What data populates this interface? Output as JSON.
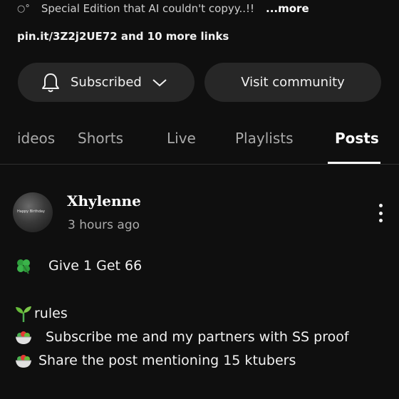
{
  "description": {
    "bullet": "○°",
    "text": "Special Edition that AI couldn't copyy..!!",
    "more": "...more"
  },
  "links_text": "pin.it/3Z2j2UE72 and 10 more links",
  "buttons": {
    "subscribed_label": "Subscribed",
    "visit_label": "Visit community"
  },
  "tabs": [
    {
      "label": "ideos",
      "active": false
    },
    {
      "label": "Shorts",
      "active": false
    },
    {
      "label": "Live",
      "active": false
    },
    {
      "label": "Playlists",
      "active": false
    },
    {
      "label": "Posts",
      "active": true
    }
  ],
  "post": {
    "author": "Xhylenne",
    "time": "3 hours ago",
    "avatar_text": "Happy Birthday",
    "lines": [
      {
        "emoji": "four-leaf-clover-icon",
        "text": "Give 1 Get 66"
      },
      {
        "emoji": "seedling-icon",
        "text": "rules"
      },
      {
        "emoji": "salad-bowl-icon",
        "text": "Subscribe me and my partners with SS proof"
      },
      {
        "emoji": "salad-bowl-icon",
        "text": "Share the post mentioning 15 ktubers"
      }
    ]
  },
  "colors": {
    "background": "#0f0f0f",
    "button_bg": "#272727",
    "inactive_tab": "#aaaaaa",
    "text": "#f1f1f1"
  }
}
